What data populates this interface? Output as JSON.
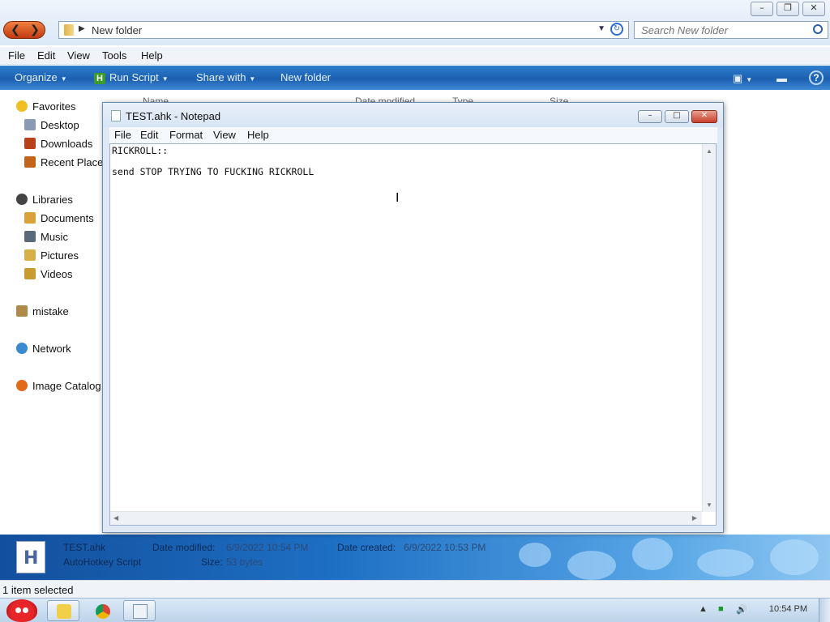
{
  "explorer": {
    "address": {
      "path": "New folder"
    },
    "search": {
      "placeholder": "Search New folder"
    },
    "menu": [
      "File",
      "Edit",
      "View",
      "Tools",
      "Help"
    ],
    "commands": {
      "organize": "Organize",
      "run_script": "Run Script",
      "share_with": "Share with",
      "new_folder": "New folder"
    },
    "columns": [
      "Name",
      "Date modified",
      "Type",
      "Size"
    ],
    "sidebar": {
      "favorites": "Favorites",
      "desktop": "Desktop",
      "downloads": "Downloads",
      "recent_places": "Recent Place",
      "libraries": "Libraries",
      "documents": "Documents",
      "music": "Music",
      "pictures": "Pictures",
      "videos": "Videos",
      "homegroup": "mistake",
      "network": "Network",
      "image_catalog": "Image Catalog"
    },
    "details": {
      "file_name": "TEST.ahk",
      "file_type": "AutoHotkey Script",
      "date_modified_label": "Date modified:",
      "date_modified_value": "6/9/2022 10:54 PM",
      "size_label": "Size:",
      "size_value": "53 bytes",
      "date_created_label": "Date created:",
      "date_created_value": "6/9/2022 10:53 PM",
      "icon_letter": "H"
    },
    "status": "1 item selected"
  },
  "notepad": {
    "title": "TEST.ahk - Notepad",
    "menu": [
      "File",
      "Edit",
      "Format",
      "View",
      "Help"
    ],
    "content": "RICKROLL::\n\nsend STOP TRYING TO FUCKING RICKROLL"
  },
  "taskbar": {
    "clock": "10:54 PM"
  },
  "colors": {
    "command_bar": "#1b5fb0",
    "details_pane": "#1d6fc4",
    "nav_orange": "#c23a10"
  }
}
